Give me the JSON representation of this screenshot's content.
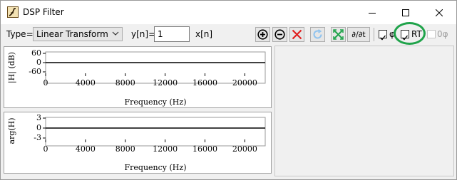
{
  "window": {
    "title": "DSP Filter"
  },
  "toolbar": {
    "type_label": "Type=",
    "type_value": "Linear Transform",
    "yn_label": "y[n]=",
    "yn_value": "1",
    "xn_label": "x[n]",
    "deriv_label": "∂/∂t",
    "check1_label": "φ",
    "rt_label": "RT",
    "zero_phi_label": "0φ"
  },
  "magnitude_plot": {
    "ylabel": "|H| (dB)",
    "xlabel": "Frequency (Hz)",
    "yticks": [
      "60",
      "0",
      "-60"
    ],
    "xticks": [
      "0",
      "4000",
      "8000",
      "12000",
      "16000",
      "20000"
    ]
  },
  "phase_plot": {
    "ylabel": "arg(H)",
    "xlabel": "Frequency (Hz)",
    "yticks": [
      "3",
      "0",
      "-3"
    ],
    "xticks": [
      "0",
      "4000",
      "8000",
      "12000",
      "16000",
      "20000"
    ]
  },
  "chart_data": [
    {
      "type": "line",
      "xlabel": "Frequency (Hz)",
      "ylabel": "|H| (dB)",
      "xlim": [
        0,
        22050
      ],
      "ylim": [
        -60,
        60
      ],
      "series": [
        {
          "x": [
            0,
            22050
          ],
          "y": [
            0,
            0
          ]
        }
      ]
    },
    {
      "type": "line",
      "xlabel": "Frequency (Hz)",
      "ylabel": "arg(H)",
      "xlim": [
        0,
        22050
      ],
      "ylim": [
        -3,
        3
      ],
      "series": [
        {
          "x": [
            0,
            22050
          ],
          "y": [
            0,
            0
          ]
        }
      ]
    }
  ],
  "colors": {
    "highlight_circle": "#1fa34a",
    "delete_red": "#e02020",
    "refresh_blue": "#8fc3ef",
    "zoom_green": "#1fa34a",
    "deriv_blue": "#000080"
  },
  "icons": [
    "app-icon",
    "minimize-icon",
    "maximize-icon",
    "close-icon",
    "chevron-down-icon",
    "zoom-in-icon",
    "zoom-out-icon",
    "delete-icon",
    "refresh-icon",
    "fit-icon"
  ]
}
